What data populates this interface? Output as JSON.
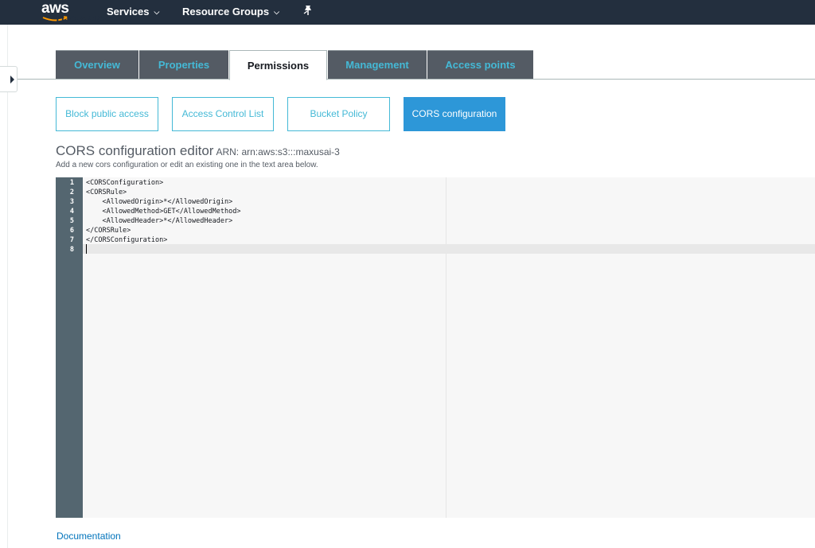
{
  "nav": {
    "logo_text": "aws",
    "services_label": "Services",
    "resource_groups_label": "Resource Groups"
  },
  "bucket": {
    "name": "maxusai-3"
  },
  "tabs": [
    {
      "label": "Overview"
    },
    {
      "label": "Properties"
    },
    {
      "label": "Permissions"
    },
    {
      "label": "Management"
    },
    {
      "label": "Access points"
    }
  ],
  "active_tab": "Permissions",
  "subtabs": [
    {
      "label": "Block public access"
    },
    {
      "label": "Access Control List"
    },
    {
      "label": "Bucket Policy"
    },
    {
      "label": "CORS configuration"
    }
  ],
  "active_subtab": "CORS configuration",
  "editor": {
    "title": "CORS configuration editor",
    "arn": "ARN: arn:aws:s3:::maxusai-3",
    "subtitle": "Add a new cors configuration or edit an existing one in the text area below.",
    "line_numbers": [
      "1",
      "2",
      "3",
      "4",
      "5",
      "6",
      "7",
      "8"
    ],
    "lines": [
      "<CORSConfiguration>",
      "<CORSRule>",
      "    <AllowedOrigin>*</AllowedOrigin>",
      "    <AllowedMethod>GET</AllowedMethod>",
      "    <AllowedHeader>*</AllowedHeader>",
      "</CORSRule>",
      "</CORSConfiguration>",
      ""
    ]
  },
  "footer": {
    "documentation_link": "Documentation"
  },
  "colors": {
    "nav_bg": "#232f3e",
    "tab_bg": "#545b64",
    "tab_text": "#44b9d6",
    "accent": "#2d97d8",
    "link": "#0073bb"
  }
}
